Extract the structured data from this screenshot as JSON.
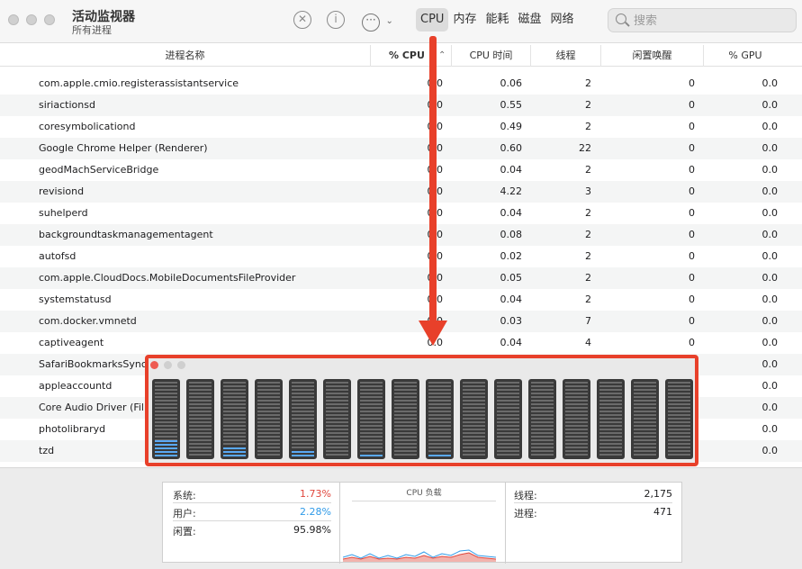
{
  "app": {
    "title": "活动监视器",
    "subtitle": "所有进程"
  },
  "toolbar": {
    "stop_icon": "x-circle-icon",
    "info_icon": "info-icon",
    "more_icon": "ellipsis-icon",
    "tabs": [
      {
        "label": "CPU",
        "active": true
      },
      {
        "label": "内存"
      },
      {
        "label": "能耗"
      },
      {
        "label": "磁盘"
      },
      {
        "label": "网络"
      }
    ],
    "search_placeholder": "搜索"
  },
  "table": {
    "headers": {
      "name": "进程名称",
      "cpu": "% CPU",
      "cpu_time": "CPU 时间",
      "threads": "线程",
      "idle_wake": "闲置唤醒",
      "gpu": "% GPU"
    },
    "rows": [
      {
        "name": "com.apple.cmio.registerassistantservice",
        "cpu": "0.0",
        "time": "0.06",
        "threads": "2",
        "wake": "0",
        "gpu": "0.0"
      },
      {
        "name": "siriactionsd",
        "cpu": "0.0",
        "time": "0.55",
        "threads": "2",
        "wake": "0",
        "gpu": "0.0"
      },
      {
        "name": "coresymbolicationd",
        "cpu": "0.0",
        "time": "0.49",
        "threads": "2",
        "wake": "0",
        "gpu": "0.0"
      },
      {
        "name": "Google Chrome Helper (Renderer)",
        "cpu": "0.0",
        "time": "0.60",
        "threads": "22",
        "wake": "0",
        "gpu": "0.0"
      },
      {
        "name": "geodMachServiceBridge",
        "cpu": "0.0",
        "time": "0.04",
        "threads": "2",
        "wake": "0",
        "gpu": "0.0"
      },
      {
        "name": "revisiond",
        "cpu": "0.0",
        "time": "4.22",
        "threads": "3",
        "wake": "0",
        "gpu": "0.0"
      },
      {
        "name": "suhelperd",
        "cpu": "0.0",
        "time": "0.04",
        "threads": "2",
        "wake": "0",
        "gpu": "0.0"
      },
      {
        "name": "backgroundtaskmanagementagent",
        "cpu": "0.0",
        "time": "0.08",
        "threads": "2",
        "wake": "0",
        "gpu": "0.0"
      },
      {
        "name": "autofsd",
        "cpu": "0.0",
        "time": "0.02",
        "threads": "2",
        "wake": "0",
        "gpu": "0.0"
      },
      {
        "name": "com.apple.CloudDocs.MobileDocumentsFileProvider",
        "cpu": "0.0",
        "time": "0.05",
        "threads": "2",
        "wake": "0",
        "gpu": "0.0"
      },
      {
        "name": "systemstatusd",
        "cpu": "0.0",
        "time": "0.04",
        "threads": "2",
        "wake": "0",
        "gpu": "0.0"
      },
      {
        "name": "com.docker.vmnetd",
        "cpu": "0.0",
        "time": "0.03",
        "threads": "7",
        "wake": "0",
        "gpu": "0.0"
      },
      {
        "name": "captiveagent",
        "cpu": "0.0",
        "time": "0.04",
        "threads": "4",
        "wake": "0",
        "gpu": "0.0"
      },
      {
        "name": "SafariBookmarksSyncAgent",
        "cpu": "",
        "time": "",
        "threads": "",
        "wake": "",
        "gpu": "0.0"
      },
      {
        "name": "appleaccountd",
        "cpu": "",
        "time": "",
        "threads": "",
        "wake": "",
        "gpu": "0.0"
      },
      {
        "name": "Core Audio Driver (FilmLight)",
        "cpu": "",
        "time": "",
        "threads": "",
        "wake": "",
        "gpu": "0.0"
      },
      {
        "name": "photolibraryd",
        "cpu": "",
        "time": "",
        "threads": "",
        "wake": "",
        "gpu": "0.0"
      },
      {
        "name": "tzd",
        "cpu": "",
        "time": "",
        "threads": "",
        "wake": "",
        "gpu": "0.0"
      }
    ]
  },
  "stats": {
    "system_label": "系统:",
    "system_value": "1.73%",
    "user_label": "用户:",
    "user_value": "2.28%",
    "idle_label": "闲置:",
    "idle_value": "95.98%",
    "load_title": "CPU 负载",
    "threads_label": "线程:",
    "threads_value": "2,175",
    "processes_label": "进程:",
    "processes_value": "471"
  },
  "colors": {
    "system": "#e0463c",
    "user": "#2f9ae8",
    "annotation": "#e8402a",
    "bar_fill": "#5aa9f5"
  },
  "cpu_history": {
    "cores": [
      0.22,
      0.0,
      0.14,
      0.0,
      0.08,
      0.0,
      0.05,
      0.0,
      0.05,
      0.0,
      0.0,
      0.0,
      0.0,
      0.0,
      0.0,
      0.0
    ]
  }
}
